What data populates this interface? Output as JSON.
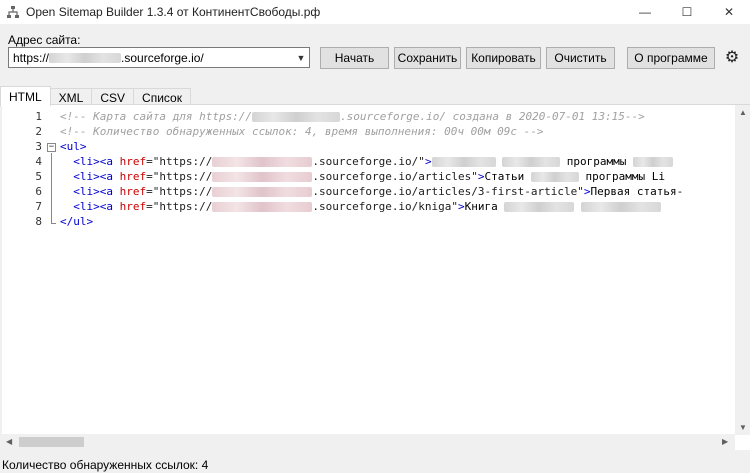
{
  "window": {
    "title": "Open Sitemap Builder 1.3.4 от КонтинентСвободы.рф",
    "minimize": "—",
    "maximize": "☐",
    "close": "✕"
  },
  "address": {
    "label": "Адрес сайта:",
    "prefix": "https://",
    "suffix": ".sourceforge.io/"
  },
  "toolbar": {
    "start": "Начать",
    "save": "Сохранить",
    "copy": "Копировать",
    "clear": "Очистить",
    "about": "О программе"
  },
  "tabs": [
    "HTML",
    "XML",
    "CSV",
    "Список"
  ],
  "editor": {
    "line_numbers": [
      "1",
      "2",
      "3",
      "4",
      "5",
      "6",
      "7",
      "8"
    ],
    "line1": {
      "a": "<!-- Карта сайта для https://",
      "b": ".sourceforge.io/ создана в 2020-07-01 13:15-->"
    },
    "line2": "<!-- Количество обнаруженных ссылок: 4, время выполнения: 00ч 00м 09с -->",
    "line3": "<ul>",
    "line4": {
      "open": "<li><a ",
      "attr": "href",
      "eq": "=\"https://",
      "url": ".sourceforge.io/\"",
      "close": ">",
      "text": " программы "
    },
    "line5": {
      "open": "<li><a ",
      "attr": "href",
      "eq": "=\"https://",
      "url": ".sourceforge.io/articles\"",
      "close": ">",
      "text": "Статьи ",
      "text2": " программы Li"
    },
    "line6": {
      "open": "<li><a ",
      "attr": "href",
      "eq": "=\"https://",
      "url": ".sourceforge.io/articles/3-first-article\"",
      "close": ">",
      "text": "Первая статья-"
    },
    "line7": {
      "open": "<li><a ",
      "attr": "href",
      "eq": "=\"https://",
      "url": ".sourceforge.io/kniga\"",
      "close": ">",
      "text": "Книга "
    },
    "line8": "</ul>"
  },
  "status": {
    "links_found": "Количество обнаруженных ссылок: 4"
  }
}
